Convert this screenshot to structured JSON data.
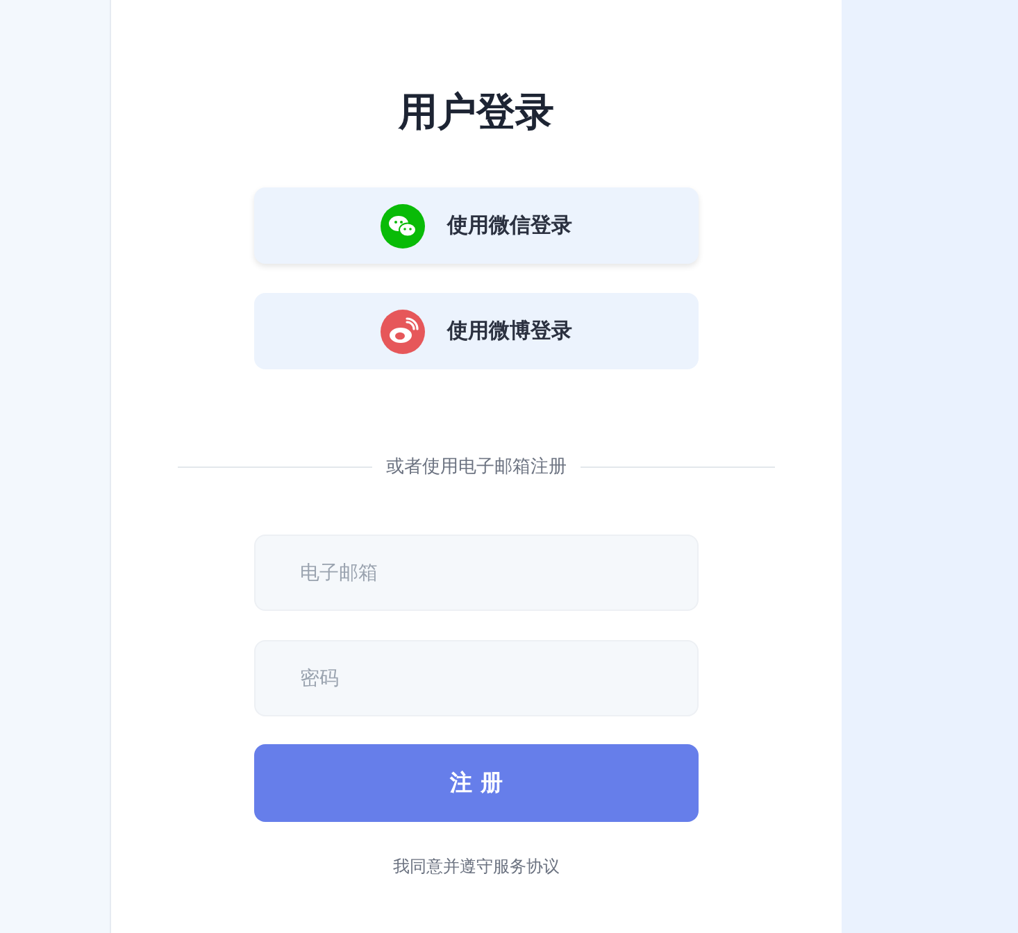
{
  "title": "用户登录",
  "social_buttons": [
    {
      "kind": "wechat",
      "label": "使用微信登录",
      "color": "#09bb07"
    },
    {
      "kind": "weibo",
      "label": "使用微博登录",
      "color": "#e6575a"
    }
  ],
  "divider_text": "或者使用电子邮箱注册",
  "fields": [
    {
      "placeholder": "电子邮箱"
    },
    {
      "placeholder": "密码"
    }
  ],
  "submit_button": "注 册",
  "agreement": "我同意并遵守服务协议"
}
